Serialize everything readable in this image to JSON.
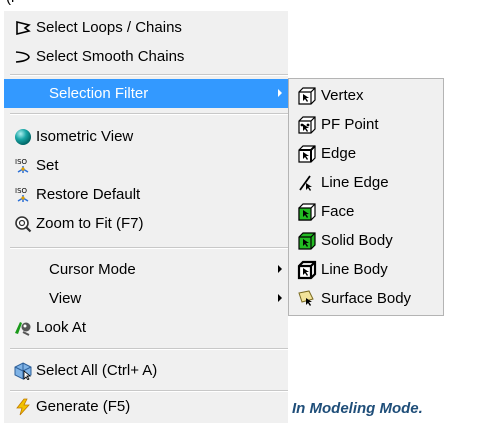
{
  "top_fragment": "(i",
  "main_menu": {
    "items": [
      {
        "label": "Select Loops / Chains",
        "icon": "loop-chain-icon"
      },
      {
        "label": "Select Smooth Chains",
        "icon": "smooth-chain-icon"
      },
      {
        "label": "Selection Filter",
        "icon": "none",
        "highlighted": true,
        "submenu": true
      },
      {
        "label": "Isometric View",
        "icon": "isometric-sphere-icon"
      },
      {
        "label": "Set",
        "icon": "iso-set-icon"
      },
      {
        "label": "Restore Default",
        "icon": "iso-restore-icon"
      },
      {
        "label": "Zoom to Fit (F7)",
        "icon": "zoom-fit-icon"
      },
      {
        "label": "Cursor Mode",
        "icon": "none",
        "submenu": true
      },
      {
        "label": "View",
        "icon": "none",
        "submenu": true
      },
      {
        "label": "Look At",
        "icon": "look-at-icon"
      },
      {
        "label": "Select All (Ctrl+ A)",
        "icon": "select-all-icon"
      },
      {
        "label": "Generate (F5)",
        "icon": "generate-lightning-icon"
      }
    ]
  },
  "submenu": {
    "items": [
      {
        "label": "Vertex",
        "icon": "vertex-filter-icon"
      },
      {
        "label": "PF Point",
        "icon": "pf-point-filter-icon"
      },
      {
        "label": "Edge",
        "icon": "edge-filter-icon"
      },
      {
        "label": "Line Edge",
        "icon": "line-edge-filter-icon"
      },
      {
        "label": "Face",
        "icon": "face-filter-icon"
      },
      {
        "label": "Solid Body",
        "icon": "solid-body-filter-icon"
      },
      {
        "label": "Line Body",
        "icon": "line-body-filter-icon"
      },
      {
        "label": "Surface Body",
        "icon": "surface-body-filter-icon"
      }
    ]
  },
  "caption": "In Modeling Mode.",
  "colors": {
    "highlight": "#3399ff",
    "menu_bg": "#f0f0f0",
    "caption": "#1f4e79",
    "solid_green": "#22bb22"
  }
}
